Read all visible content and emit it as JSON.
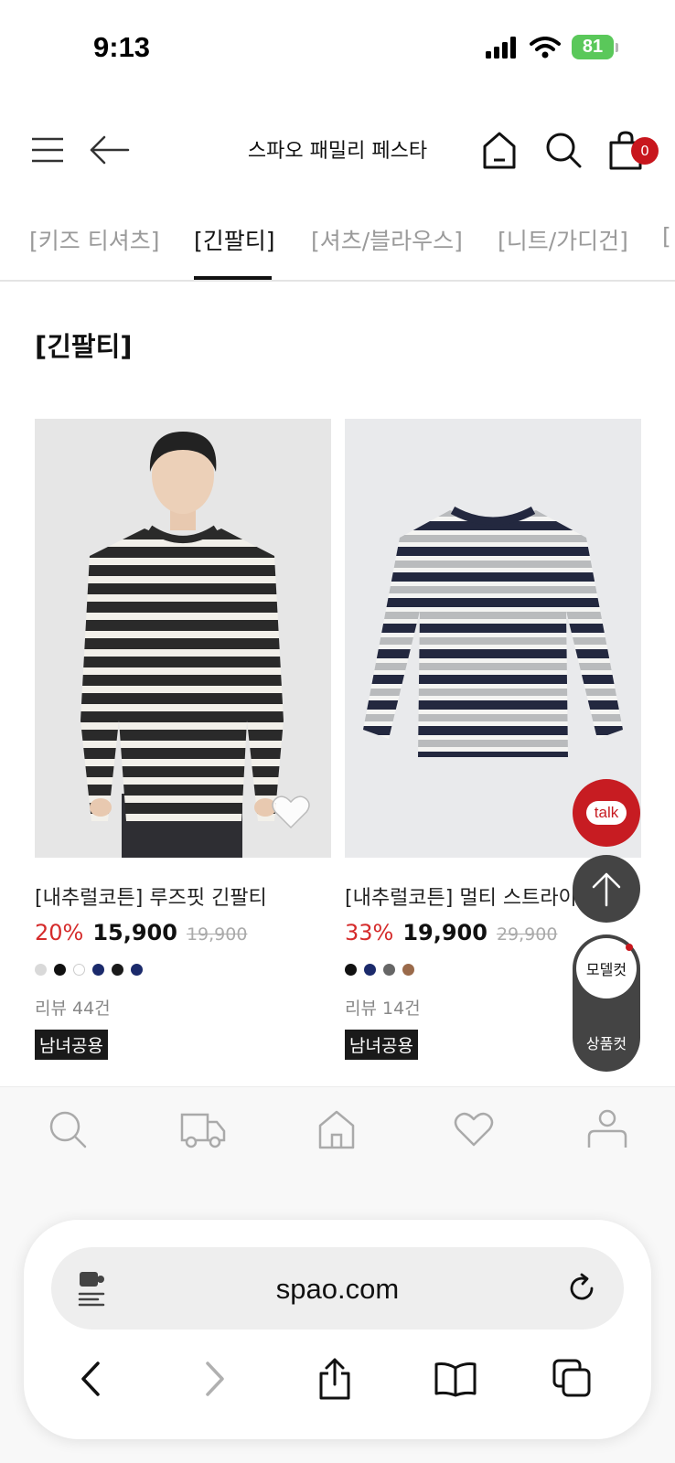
{
  "status_bar": {
    "time": "9:13",
    "battery": "81"
  },
  "header": {
    "title": "스파오 패밀리 페스타",
    "cart_count": "0",
    "icons": [
      "menu-icon",
      "back-arrow-icon",
      "home-icon",
      "search-icon",
      "shopping-bag-icon"
    ]
  },
  "category_tabs": [
    {
      "label": "[키즈 티셔츠]",
      "active": false
    },
    {
      "label": "[긴팔티]",
      "active": true
    },
    {
      "label": "[셔츠/블라우스]",
      "active": false
    },
    {
      "label": "[니트/가디건]",
      "active": false
    }
  ],
  "section_title": "[긴팔티]",
  "products": [
    {
      "name": "[내추럴코튼] 루즈핏 긴팔티",
      "discount": "20%",
      "price": "15,900",
      "original_price": "19,900",
      "swatch_colors": [
        "#d9d9d9",
        "#111111",
        "#ffffff",
        "#1b2a6b",
        "#1a1a1a",
        "#1b2a6b"
      ],
      "review": "리뷰 44건",
      "badge": "남녀공용",
      "wishlist_icon": "heart-icon"
    },
    {
      "name": "[내추럴코튼] 멀티 스트라이",
      "discount": "33%",
      "price": "19,900",
      "original_price": "29,900",
      "swatch_colors": [
        "#111111",
        "#1b2a6b",
        "#666666",
        "#9a6a4a"
      ],
      "review": "리뷰 14건",
      "badge": "남녀공용"
    }
  ],
  "floating": {
    "talk_label": "talk",
    "model_label": "모델컷",
    "product_label": "상품컷"
  },
  "bottom_nav": [
    "search-icon",
    "truck-icon",
    "home-icon",
    "heart-icon",
    "user-icon"
  ],
  "browser": {
    "url": "spao.com",
    "toolbar": [
      "back-icon",
      "forward-icon",
      "share-icon",
      "bookmarks-icon",
      "tabs-icon"
    ]
  },
  "colors": {
    "accent_red": "#c8161d",
    "discount_red": "#d52b2b",
    "battery_green": "#5ac85a"
  }
}
